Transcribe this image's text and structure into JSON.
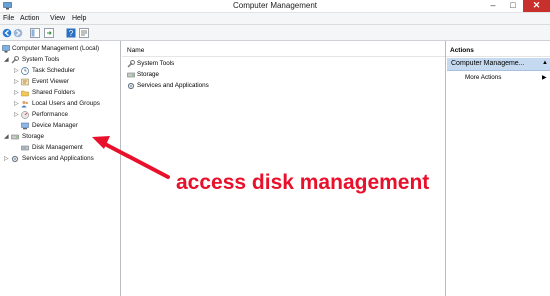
{
  "window": {
    "title": "Computer Management",
    "minimize": "–",
    "maximize": "□",
    "close": "✕"
  },
  "menu": [
    "File",
    "Action",
    "View",
    "Help"
  ],
  "tree": {
    "root": "Computer Management (Local)",
    "system_tools": "System Tools",
    "task_scheduler": "Task Scheduler",
    "event_viewer": "Event Viewer",
    "shared_folders": "Shared Folders",
    "local_users": "Local Users and Groups",
    "performance": "Performance",
    "device_manager": "Device Manager",
    "storage": "Storage",
    "disk_management": "Disk Management",
    "services": "Services and Applications"
  },
  "list": {
    "column_name": "Name",
    "items": [
      "System Tools",
      "Storage",
      "Services and Applications"
    ]
  },
  "actions": {
    "header": "Actions",
    "selected": "Computer Manageme...",
    "more": "More Actions"
  },
  "annotation": "access disk management",
  "colors": {
    "annotation": "#e8102b",
    "selection": "#c5daf0",
    "close": "#c7302b"
  }
}
